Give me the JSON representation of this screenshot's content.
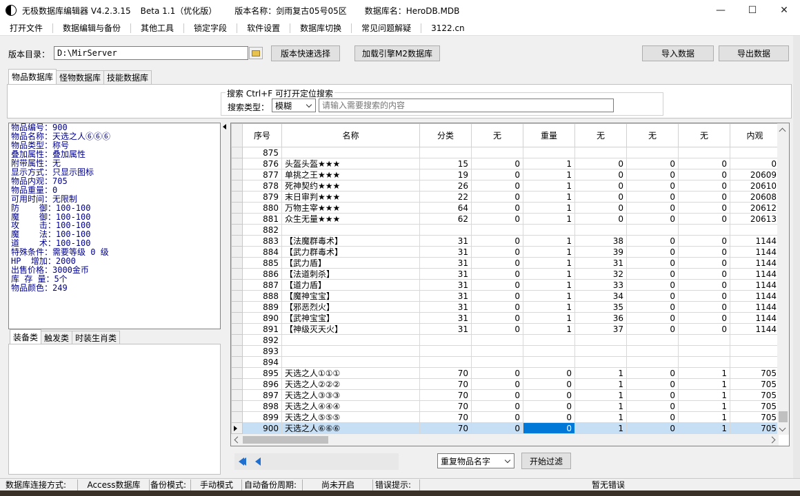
{
  "window": {
    "title_app": "无极数据库编辑器 V4.2.3.15",
    "title_beta": "Beta 1.1（优化版）",
    "title_version_name": "版本名称：剑雨复古05号05区",
    "title_db_name": "数据库名：HeroDB.MDB",
    "minimize": "—",
    "maximize": "☐",
    "close": "✕"
  },
  "menu": [
    "打开文件",
    "数据编辑与备份",
    "其他工具",
    "锁定字段",
    "软件设置",
    "数据库切换",
    "常见问题解疑",
    "3122.cn"
  ],
  "path": {
    "label": "版本目录：",
    "value": "D:\\MirServer",
    "quick_select": "版本快速选择",
    "load_m2": "加载引擎M2数据库",
    "import": "导入数据",
    "export": "导出数据"
  },
  "main_tabs": [
    "物品数据库",
    "怪物数据库",
    "技能数据库"
  ],
  "search": {
    "legend": "搜索  Ctrl+F 可打开定位搜索",
    "type_label": "搜索类型：",
    "type_value": "模糊",
    "placeholder": "请输入需要搜索的内容"
  },
  "properties": [
    "物品编号：900",
    "物品名称：天选之人⑥⑥⑥",
    "物品类型：称号",
    "叠加属性：叠加属性",
    "附带属性：无",
    "显示方式：只显示图标",
    "物品内观：705",
    "物品重量：0",
    "可用时间：无限制",
    "防    御：100-100",
    "魔    御：100-100",
    "攻    击：100-100",
    "魔    法：100-100",
    "道    术：100-100",
    "特殊条件：需要等级 0 级",
    "HP  增加：2000",
    "出售价格：3000金币",
    "库 存 量：5个",
    "物品颜色：249"
  ],
  "sub_tabs": [
    "装备类",
    "触发类",
    "时装生肖类"
  ],
  "grid": {
    "columns": [
      "序号",
      "名称",
      "分类",
      "无",
      "重量",
      "无",
      "无",
      "无",
      "内观"
    ],
    "rows": [
      [
        "875",
        "",
        "",
        "",
        "",
        "",
        "",
        "",
        ""
      ],
      [
        "876",
        "头盔头盔★★★",
        "15",
        "0",
        "1",
        "0",
        "0",
        "0",
        "0"
      ],
      [
        "877",
        "单挑之王★★★",
        "19",
        "0",
        "1",
        "0",
        "0",
        "0",
        "20609"
      ],
      [
        "878",
        "死神契约★★★",
        "26",
        "0",
        "1",
        "0",
        "0",
        "0",
        "20610"
      ],
      [
        "879",
        "末日审判★★★",
        "22",
        "0",
        "1",
        "0",
        "0",
        "0",
        "20608"
      ],
      [
        "880",
        "万物主宰★★★",
        "64",
        "0",
        "1",
        "0",
        "0",
        "0",
        "20612"
      ],
      [
        "881",
        "众生无量★★★",
        "62",
        "0",
        "1",
        "0",
        "0",
        "0",
        "20613"
      ],
      [
        "882",
        "",
        "",
        "",
        "",
        "",
        "",
        "",
        ""
      ],
      [
        "883",
        "【法魔群毒术】",
        "31",
        "0",
        "1",
        "38",
        "0",
        "0",
        "1144"
      ],
      [
        "884",
        "【武力群毒术】",
        "31",
        "0",
        "1",
        "39",
        "0",
        "0",
        "1144"
      ],
      [
        "885",
        "【武力盾】",
        "31",
        "0",
        "1",
        "31",
        "0",
        "0",
        "1144"
      ],
      [
        "886",
        "【法道刺杀】",
        "31",
        "0",
        "1",
        "32",
        "0",
        "0",
        "1144"
      ],
      [
        "887",
        "【道力盾】",
        "31",
        "0",
        "1",
        "33",
        "0",
        "0",
        "1144"
      ],
      [
        "888",
        "【魔神宝宝】",
        "31",
        "0",
        "1",
        "34",
        "0",
        "0",
        "1144"
      ],
      [
        "889",
        "【邪恶烈火】",
        "31",
        "0",
        "1",
        "35",
        "0",
        "0",
        "1144"
      ],
      [
        "890",
        "【武神宝宝】",
        "31",
        "0",
        "1",
        "36",
        "0",
        "0",
        "1144"
      ],
      [
        "891",
        "【神级灭天火】",
        "31",
        "0",
        "1",
        "37",
        "0",
        "0",
        "1144"
      ],
      [
        "892",
        "",
        "",
        "",
        "",
        "",
        "",
        "",
        ""
      ],
      [
        "893",
        "",
        "",
        "",
        "",
        "",
        "",
        "",
        ""
      ],
      [
        "894",
        "",
        "",
        "",
        "",
        "",
        "",
        "",
        ""
      ],
      [
        "895",
        "天选之人①①①",
        "70",
        "0",
        "0",
        "1",
        "0",
        "1",
        "705"
      ],
      [
        "896",
        "天选之人②②②",
        "70",
        "0",
        "0",
        "1",
        "0",
        "1",
        "705"
      ],
      [
        "897",
        "天选之人③③③",
        "70",
        "0",
        "0",
        "1",
        "0",
        "1",
        "705"
      ],
      [
        "898",
        "天选之人④④④",
        "70",
        "0",
        "0",
        "1",
        "0",
        "1",
        "705"
      ],
      [
        "899",
        "天选之人⑤⑤⑤",
        "70",
        "0",
        "0",
        "1",
        "0",
        "1",
        "705"
      ],
      [
        "900",
        "天选之人⑥⑥⑥",
        "70",
        "0",
        "0",
        "1",
        "0",
        "1",
        "705"
      ]
    ],
    "selected_row": 25,
    "selected_col": 4
  },
  "filter": {
    "value": "重复物品名字",
    "start_button": "开始过滤"
  },
  "status": {
    "conn_label": "数据库连接方式:",
    "conn_value": "Access数据库",
    "backup_label": "备份模式:",
    "backup_value": "手动模式",
    "auto_label": "自动备份周期:",
    "auto_value": "尚未开启",
    "error_label": "错误提示:",
    "error_value": "暂无错误"
  }
}
